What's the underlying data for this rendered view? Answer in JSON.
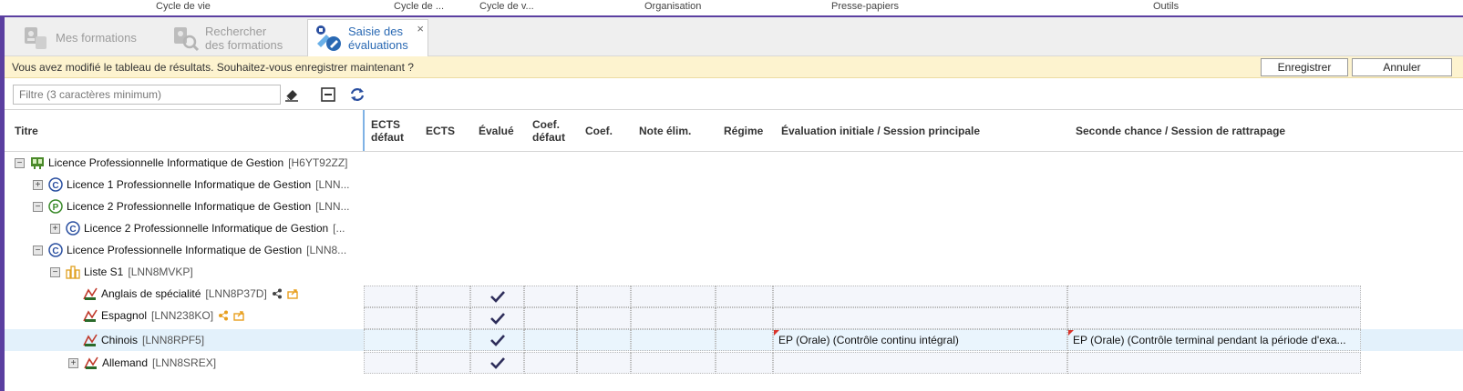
{
  "ribbon": {
    "groups": [
      "Cycle de vie",
      "Cycle de ...",
      "Cycle de v...",
      "Organisation",
      "Presse-papiers",
      "Outils"
    ]
  },
  "tabs": [
    {
      "line1": "Mes formations",
      "line2": "",
      "active": false
    },
    {
      "line1": "Rechercher",
      "line2": "des formations",
      "active": false
    },
    {
      "line1": "Saisie des",
      "line2": "évaluations",
      "active": true,
      "close": "×"
    }
  ],
  "notice": {
    "message": "Vous avez modifié le tableau de résultats. Souhaitez-vous enregistrer maintenant ?",
    "save_label": "Enregistrer",
    "cancel_label": "Annuler"
  },
  "toolbar": {
    "filter_placeholder": "Filtre (3 caractères minimum)",
    "icons": [
      "eraser-icon",
      "collapse-all-icon",
      "refresh-icon"
    ]
  },
  "columns": {
    "title": "Titre",
    "ects_default_1": "ECTS",
    "ects_default_2": "défaut",
    "ects": "ECTS",
    "evalue": "Évalué",
    "coef_default_1": "Coef.",
    "coef_default_2": "défaut",
    "coef": "Coef.",
    "note_elim": "Note élim.",
    "regime": "Régime",
    "eval_initiale": "Évaluation initiale / Session principale",
    "seconde_chance": "Seconde chance / Session de rattrapage"
  },
  "tree": [
    {
      "label": "Licence Professionnelle Informatique de Gestion",
      "code": "[H6YT92ZZ]",
      "expander": "−",
      "icon": "diploma-icon"
    },
    {
      "label": "Licence 1 Professionnelle Informatique de Gestion",
      "code": "[LNN...",
      "expander": "+",
      "icon": "c-circle-icon"
    },
    {
      "label": "Licence 2 Professionnelle Informatique de Gestion",
      "code": "[LNN...",
      "expander": "−",
      "icon": "p-circle-icon"
    },
    {
      "label": "Licence 2 Professionnelle Informatique de Gestion",
      "code": "[...",
      "expander": "+",
      "icon": "c-circle-icon"
    },
    {
      "label": "Licence Professionnelle Informatique de Gestion",
      "code": "[LNN8...",
      "expander": "−",
      "icon": "c-circle-icon"
    },
    {
      "label": "Liste S1",
      "code": "[LNN8MVKP]",
      "expander": "−",
      "icon": "list-icon"
    },
    {
      "label": "Anglais de spécialité",
      "code": "[LNN8P37D]",
      "expander": "",
      "icon": "course-icon",
      "extras": [
        "share-icon",
        "export-icon"
      ]
    },
    {
      "label": "Espagnol",
      "code": "[LNN238KO]",
      "expander": "",
      "icon": "course-icon",
      "extras": [
        "share-icon",
        "export-icon"
      ]
    },
    {
      "label": "Chinois",
      "code": "[LNN8RPF5]",
      "expander": "",
      "icon": "course-icon",
      "selected": true
    },
    {
      "label": "Allemand",
      "code": "[LNN8SREX]",
      "expander": "+",
      "icon": "course-icon"
    }
  ],
  "grid_rows": [
    {
      "evalue": true,
      "eval_initiale": "",
      "seconde_chance": ""
    },
    {
      "evalue": true,
      "eval_initiale": "",
      "seconde_chance": ""
    },
    {
      "evalue": true,
      "eval_initiale": "EP (Orale) (Contrôle continu intégral)",
      "seconde_chance": "EP (Orale) (Contrôle terminal pendant la période d'exa..."
    },
    {
      "evalue": true,
      "eval_initiale": "",
      "seconde_chance": ""
    }
  ],
  "colors": {
    "accent": "#5b3fa0",
    "tab_active_text": "#2a69b3",
    "notice_bg": "#fdf3cf",
    "selection": "#e3f1fb",
    "check": "#2d2d5a",
    "flag": "#d9342b"
  }
}
